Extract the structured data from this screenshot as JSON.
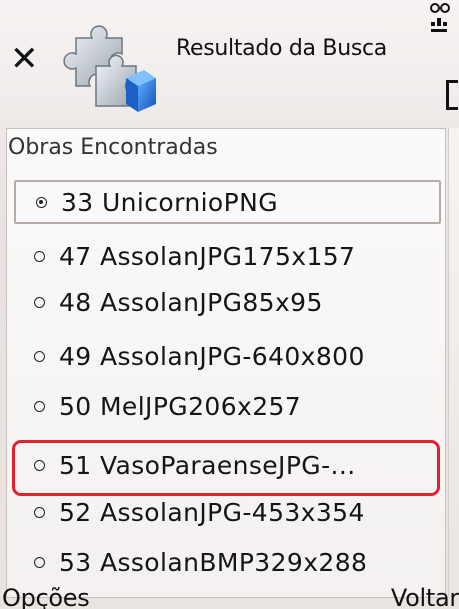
{
  "header": {
    "title": "Resultado da Busca",
    "close_icon": "close-icon",
    "app_icon": "puzzle-icon",
    "status_icon": "network-status-icon"
  },
  "list": {
    "heading": "Obras Encontradas",
    "items": [
      {
        "label": "33 UnicornioPNG",
        "selected": true
      },
      {
        "label": "47 AssolanJPG175x157",
        "selected": false
      },
      {
        "label": "48 AssolanJPG85x95",
        "selected": false
      },
      {
        "label": "49 AssolanJPG-640x800",
        "selected": false
      },
      {
        "label": "50 MelJPG206x257",
        "selected": false
      },
      {
        "label": "51 VasoParaenseJPG-...",
        "selected": false
      },
      {
        "label": "52 AssolanJPG-453x354",
        "selected": false
      },
      {
        "label": "53 AssolanBMP329x288",
        "selected": false
      }
    ]
  },
  "softkeys": {
    "left": "Opções",
    "right": "Voltar"
  },
  "colors": {
    "highlight": "#e0202a",
    "background": "#efeae8"
  }
}
